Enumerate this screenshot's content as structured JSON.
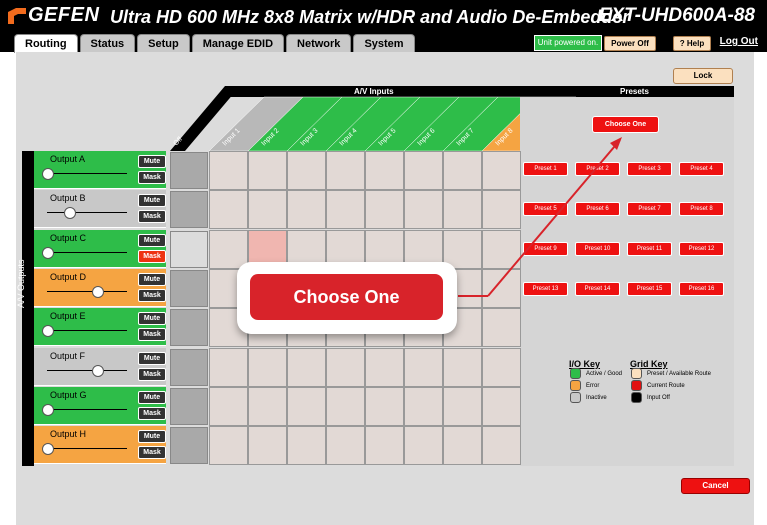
{
  "header": {
    "brand": "GEFEN",
    "title": "Ultra HD 600 MHz 8x8 Matrix w/HDR and Audio De-Embedder",
    "model": "EXT-UHD600A-88",
    "status": "Unit powered on.",
    "power_off": "Power Off",
    "help": "? Help",
    "logout": "Log Out"
  },
  "tabs": [
    "Routing",
    "Status",
    "Setup",
    "Manage EDID",
    "Network",
    "System"
  ],
  "lock_label": "Lock",
  "cancel_label": "Cancel",
  "av_inputs_label": "A/V Inputs",
  "av_outputs_label": "A/V Outputs",
  "presets_label": "Presets",
  "off_label": "Off",
  "inputs": [
    "Input 1",
    "Input 2",
    "Input 3",
    "Input 4",
    "Input 5",
    "Input 6",
    "Input 7",
    "Input 8"
  ],
  "input_colors": [
    "#b8b8b8",
    "#2ebd49",
    "#2ebd49",
    "#2ebd49",
    "#2ebd49",
    "#2ebd49",
    "#2ebd49",
    "#f5a442"
  ],
  "outputs": [
    {
      "name": "Output A",
      "mute": "Mute",
      "mask": "Mask",
      "color": "#2ebd49",
      "slider": 0.0,
      "mask_active": false
    },
    {
      "name": "Output B",
      "mute": "Mute",
      "mask": "Mask",
      "color": "#c8c8c8",
      "slider": 0.3,
      "mask_active": false
    },
    {
      "name": "Output C",
      "mute": "Mute",
      "mask": "Mask",
      "color": "#2ebd49",
      "slider": 0.0,
      "mask_active": true
    },
    {
      "name": "Output D",
      "mute": "Mute",
      "mask": "Mask",
      "color": "#f5a442",
      "slider": 0.7,
      "mask_active": false
    },
    {
      "name": "Output E",
      "mute": "Mute",
      "mask": "Mask",
      "color": "#2ebd49",
      "slider": 0.0,
      "mask_active": false
    },
    {
      "name": "Output F",
      "mute": "Mute",
      "mask": "Mask",
      "color": "#c8c8c8",
      "slider": 0.7,
      "mask_active": false
    },
    {
      "name": "Output G",
      "mute": "Mute",
      "mask": "Mask",
      "color": "#2ebd49",
      "slider": 0.0,
      "mask_active": false
    },
    {
      "name": "Output H",
      "mute": "Mute",
      "mask": "Mask",
      "color": "#f5a442",
      "slider": 0.0,
      "mask_active": false
    }
  ],
  "choose_one": "Choose One",
  "presets": [
    "Preset 1",
    "Preset 2",
    "Preset 3",
    "Preset 4",
    "Preset 5",
    "Preset 6",
    "Preset 7",
    "Preset 8",
    "Preset 9",
    "Preset 10",
    "Preset 11",
    "Preset 12",
    "Preset 13",
    "Preset 14",
    "Preset 15",
    "Preset 16"
  ],
  "io_key": {
    "title": "I/O Key",
    "items": [
      {
        "label": "Active / Good",
        "color": "#2ebd49"
      },
      {
        "label": "Error",
        "color": "#f5a442"
      },
      {
        "label": "Inactive",
        "color": "#c8c8c8"
      }
    ]
  },
  "grid_key": {
    "title": "Grid Key",
    "items": [
      {
        "label": "Preset / Available Route",
        "color": "#fbe0bf"
      },
      {
        "label": "Current Route",
        "color": "#e11111"
      },
      {
        "label": "Input Off",
        "color": "#000000"
      }
    ]
  },
  "callout_label": "Choose One"
}
